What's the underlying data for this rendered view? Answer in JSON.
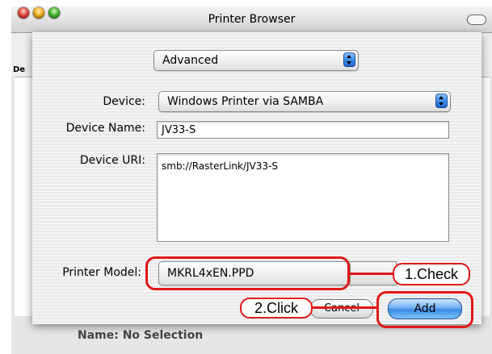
{
  "window": {
    "title": "Printer Browser",
    "column_header_fragment": "De",
    "bottom_text": "Name: No Selection"
  },
  "dialog": {
    "mode_popup": "Advanced",
    "device_label": "Device:",
    "device_value": "Windows Printer via SAMBA",
    "device_name_label": "Device Name:",
    "device_name_value": "JV33-S",
    "device_uri_label": "Device URI:",
    "device_uri_value": "smb://RasterLink/JV33-S",
    "printer_model_label": "Printer Model:",
    "printer_model_value": "MKRL4xEN.PPD",
    "cancel_label": "Cancel",
    "add_label": "Add"
  },
  "annotations": {
    "step1": "1.Check",
    "step2": "2.Click",
    "color": "#e01818"
  }
}
